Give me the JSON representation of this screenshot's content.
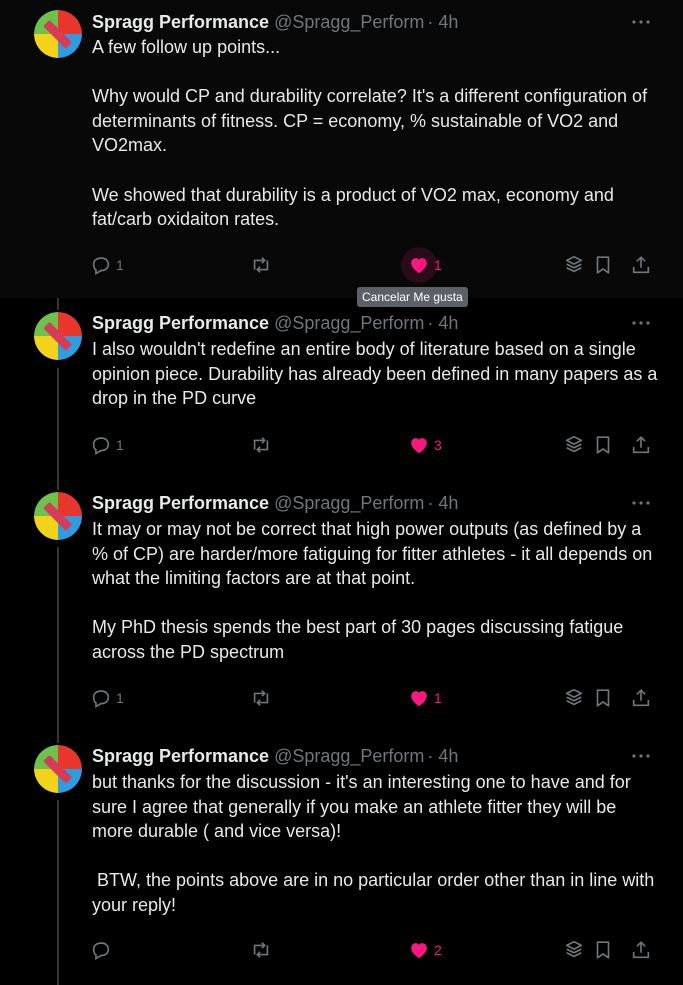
{
  "colors": {
    "like": "#f91880",
    "muted": "#71767b",
    "text": "#e7e9ea",
    "line": "#333639"
  },
  "tweets": [
    {
      "name": "Spragg Performance",
      "handle": "@Spragg_Perform",
      "time": "· 4h",
      "text": "A few follow up points...\n\nWhy would CP and durability correlate? It's a different configuration of determinants of fitness. CP = economy, % sustainable of VO2 and VO2max.\n\nWe showed that durability is a product of VO2 max, economy and fat/carb oxidaiton rates.",
      "reply_count": "1",
      "like_count": "1"
    },
    {
      "name": "Spragg Performance",
      "handle": "@Spragg_Perform",
      "time": "· 4h",
      "text": "I also wouldn't redefine an entire body of literature based on a single opinion piece. Durability has already been defined in many papers as a drop in the PD curve",
      "reply_count": "1",
      "like_count": "3"
    },
    {
      "name": "Spragg Performance",
      "handle": "@Spragg_Perform",
      "time": "· 4h",
      "text": "It may or may not be correct that high power outputs (as defined by a % of CP) are harder/more fatiguing for fitter athletes - it all depends on what the limiting factors are at that point.\n\nMy PhD thesis spends the best part of 30 pages discussing fatigue across the PD spectrum",
      "reply_count": "1",
      "like_count": "1"
    },
    {
      "name": "Spragg Performance",
      "handle": "@Spragg_Perform",
      "time": "· 4h",
      "text": "but thanks for the discussion - it's an interesting one to have and for sure I agree that generally if you make an athlete fitter they will be more durable ( and vice versa)!\n\n BTW, the points above are in no particular order other than in line with your reply!",
      "reply_count": "",
      "like_count": "2"
    }
  ],
  "tooltip": "Cancelar Me gusta"
}
